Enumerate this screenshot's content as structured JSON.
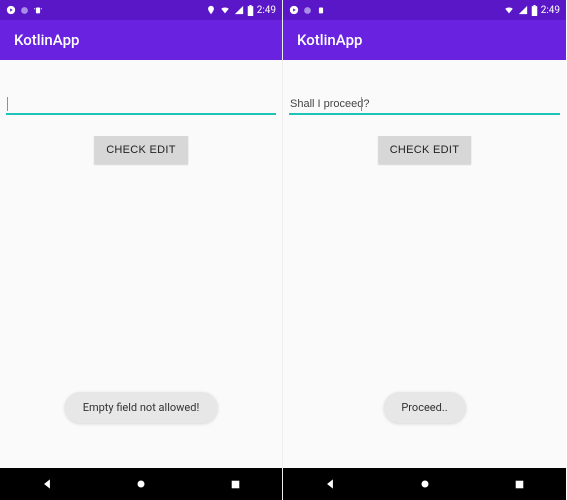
{
  "screens": {
    "left": {
      "statusbar": {
        "time": "2:49"
      },
      "appbar": {
        "title": "KotlinApp"
      },
      "input": {
        "value": ""
      },
      "button": {
        "label": "CHECK EDIT"
      },
      "toast": {
        "message": "Empty field not allowed!"
      }
    },
    "right": {
      "statusbar": {
        "time": "2:49"
      },
      "appbar": {
        "title": "KotlinApp"
      },
      "input": {
        "value": "Shall I proceed?"
      },
      "button": {
        "label": "CHECK EDIT"
      },
      "toast": {
        "message": "Proceed.."
      }
    }
  },
  "colors": {
    "statusbar": "#5a17c7",
    "appbar": "#6822e0",
    "accent": "#1fc4b8"
  }
}
